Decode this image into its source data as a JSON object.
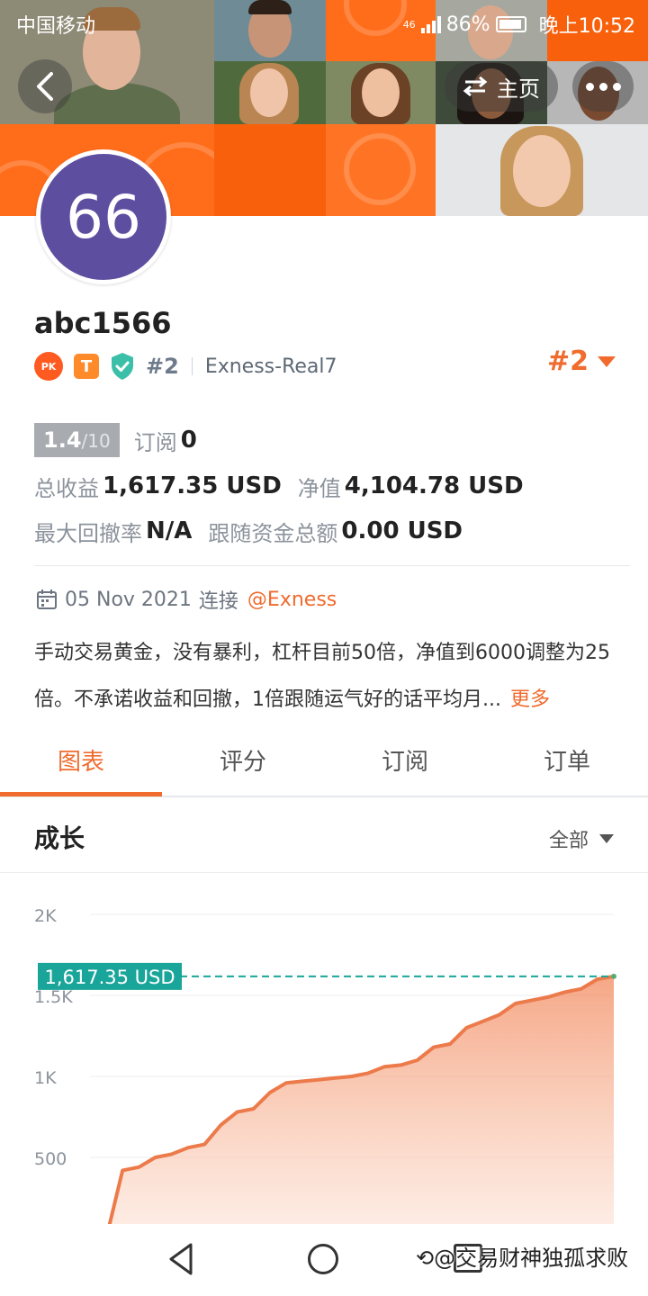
{
  "status_bar": {
    "carrier": "中国移动",
    "network": "46",
    "battery": "86%",
    "time": "晚上10:52"
  },
  "header": {
    "back_icon": "chevron-left-icon",
    "home_label": "主页",
    "swap_icon": "swap-arrows-icon",
    "more_icon": "more-dots-icon"
  },
  "profile": {
    "avatar_text": "66",
    "avatar_color": "#5e4ea0",
    "username": "abc1566",
    "pk_badge": "PK",
    "t_badge": "T",
    "rank_small": "#2",
    "server": "Exness-Real7",
    "rank_big": "#2"
  },
  "stats": {
    "score": "1.4",
    "score_max": "/10",
    "subscribe_label": "订阅",
    "subscribe_value": "0",
    "total_profit_label": "总收益",
    "total_profit_value": "1,617.35 USD",
    "equity_label": "净值",
    "equity_value": "4,104.78 USD",
    "max_drawdown_label": "最大回撤率",
    "max_drawdown_value": "N/A",
    "follow_funds_label": "跟随资金总额",
    "follow_funds_value": "0.00 USD"
  },
  "connection": {
    "date": "05 Nov 2021",
    "connect_label": "连接",
    "broker": "@Exness"
  },
  "description": {
    "text": "手动交易黄金，没有暴利，杠杆目前50倍，净值到6000调整为25倍。不承诺收益和回撤，1倍跟随运气好的话平均月...",
    "more_label": "更多"
  },
  "tabs": [
    {
      "label": "图表",
      "active": true
    },
    {
      "label": "评分",
      "active": false
    },
    {
      "label": "订阅",
      "active": false
    },
    {
      "label": "订单",
      "active": false
    }
  ],
  "growth": {
    "title": "成长",
    "range_label": "全部"
  },
  "chart_data": {
    "type": "area",
    "title": "",
    "xlabel": "",
    "ylabel": "",
    "y_ticks": [
      "2K",
      "1.5K",
      "1K",
      "500"
    ],
    "ylim": [
      0,
      2000
    ],
    "grid": true,
    "current_value_label": "1,617.35 USD",
    "current_value": 1617.35,
    "line_color": "#ec7a4a",
    "label_color": "#1aa59a",
    "series": [
      {
        "values": [
          0,
          420,
          440,
          500,
          520,
          560,
          580,
          700,
          780,
          800,
          900,
          960,
          970,
          980,
          990,
          1000,
          1020,
          1060,
          1070,
          1100,
          1180,
          1200,
          1300,
          1340,
          1380,
          1450,
          1470,
          1490,
          1520,
          1540,
          1600,
          1617.35
        ]
      }
    ]
  },
  "watermark": "交易财神独孤求败"
}
